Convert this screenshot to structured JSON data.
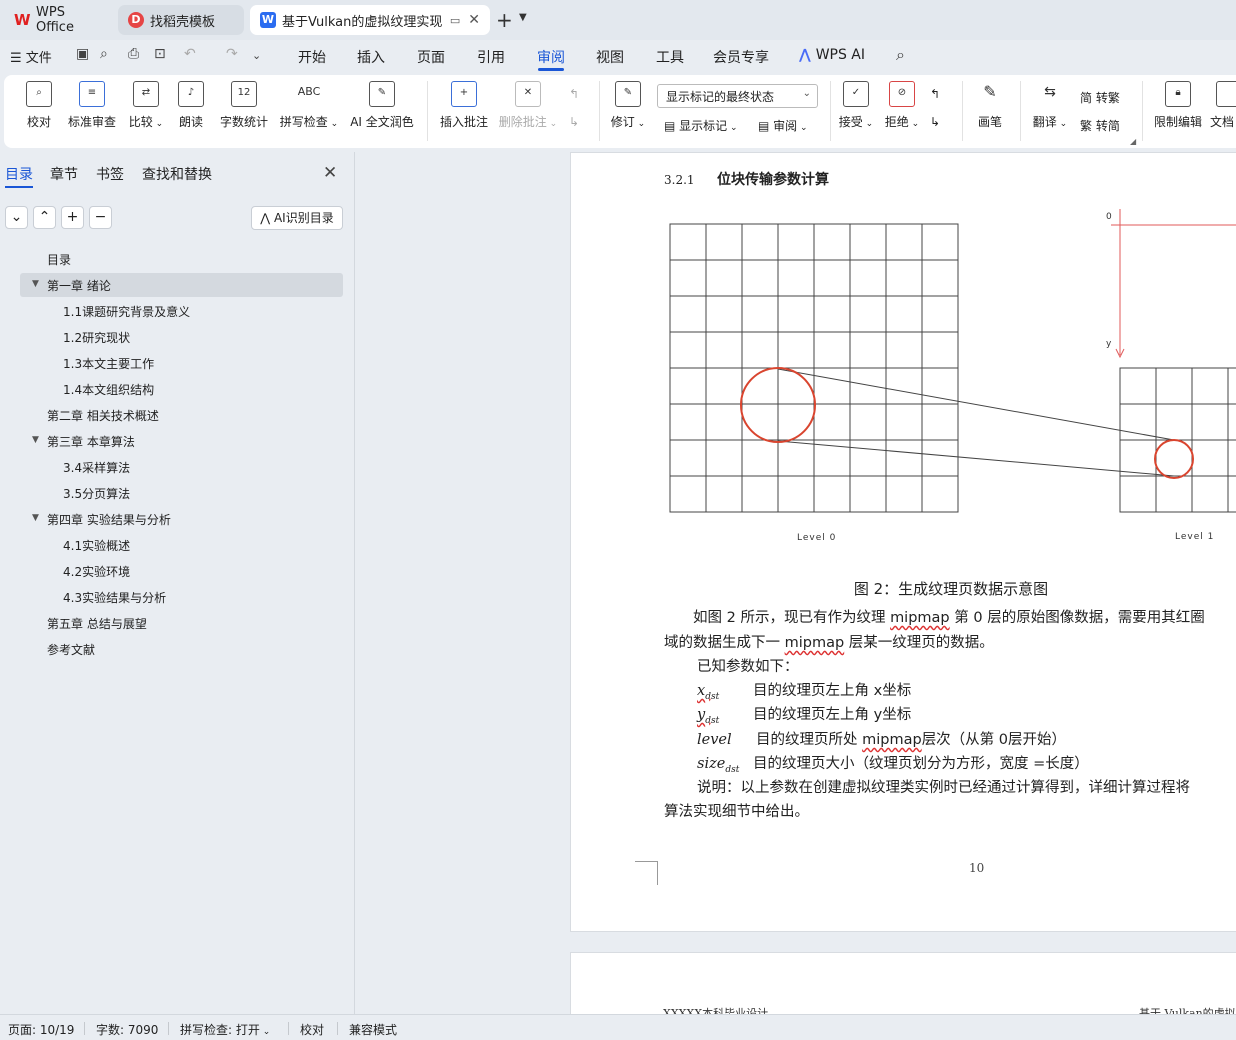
{
  "tabs": {
    "wps": "WPS Office",
    "template": "找稻壳模板",
    "document": "基于Vulkan的虚拟纹理实现 - 兰"
  },
  "menu": {
    "file": "文件",
    "items": [
      "开始",
      "插入",
      "页面",
      "引用",
      "审阅",
      "视图",
      "工具",
      "会员专享",
      "WPS AI"
    ],
    "active": "审阅"
  },
  "ribbon": {
    "proofread": "校对",
    "standard_review": "标准审查",
    "compare": "比较",
    "read_aloud": "朗读",
    "word_count": "字数统计",
    "spell_check": "拼写检查",
    "ai_polish": "AI 全文润色",
    "insert_comment": "插入批注",
    "delete_comment": "删除批注",
    "track": "修订",
    "markup_state": "显示标记的最终状态",
    "show_markup": "显示标记",
    "review": "审阅",
    "accept": "接受",
    "reject": "拒绝",
    "pen": "画笔",
    "translate": "翻译",
    "to_traditional": "转繁",
    "to_simplified": "转简",
    "restrict_edit": "限制编辑",
    "doc": "文档",
    "word_count_icon_text": "12",
    "spell_icon_text": "ABC"
  },
  "nav": {
    "tabs": [
      "目录",
      "章节",
      "书签",
      "查找和替换"
    ],
    "ai_toc": "AI识别目录",
    "toc": [
      {
        "label": "目录",
        "level": 0
      },
      {
        "label": "第一章 绪论",
        "level": 0,
        "expanded": true,
        "selected": true
      },
      {
        "label": "1.1课题研究背景及意义",
        "level": 1
      },
      {
        "label": "1.2研究现状",
        "level": 1
      },
      {
        "label": "1.3本文主要工作",
        "level": 1
      },
      {
        "label": "1.4本文组织结构",
        "level": 1
      },
      {
        "label": "第二章 相关技术概述",
        "level": 0
      },
      {
        "label": "第三章 本章算法",
        "level": 0,
        "expanded": true
      },
      {
        "label": "3.4采样算法",
        "level": 1
      },
      {
        "label": "3.5分页算法",
        "level": 1
      },
      {
        "label": "第四章 实验结果与分析",
        "level": 0,
        "expanded": true
      },
      {
        "label": "4.1实验概述",
        "level": 1
      },
      {
        "label": "4.2实验环境",
        "level": 1
      },
      {
        "label": "4.3实验结果与分析",
        "level": 1
      },
      {
        "label": "第五章 总结与展望",
        "level": 0
      },
      {
        "label": "参考文献",
        "level": 0
      }
    ]
  },
  "doc": {
    "heading_num": "3.2.1",
    "heading_text": "位块传输参数计算",
    "fig_level0": "Level 0",
    "fig_level1": "Level 1",
    "fig_axis_zero": "0",
    "fig_axis_y": "y",
    "caption": "图 2：生成纹理页数据示意图",
    "p1_a": "如图 2 所示，现已有作为纹理 ",
    "p1_mip": "mipmap",
    "p1_b": " 第 0 层的原始图像数据，需要用其红圈",
    "p2_a": "域的数据生成下一 ",
    "p2_mip": "mipmap",
    "p2_b": " 层某一纹理页的数据。",
    "known": "已知参数如下：",
    "params": [
      {
        "var": "x",
        "sub": "dst",
        "desc": "目的纹理页左上角 x坐标"
      },
      {
        "var": "y",
        "sub": "dst",
        "desc": "目的纹理页左上角 y坐标"
      },
      {
        "var": "level",
        "sub": "",
        "desc_a": "目的纹理页所处 ",
        "desc_mip": "mipmap",
        "desc_b": "层次（从第 0层开始）"
      },
      {
        "var": "size",
        "sub": "dst",
        "desc": "目的纹理页大小（纹理页划分为方形，宽度 =长度）"
      }
    ],
    "note_1": "说明：以上参数在创建虚拟纹理类实例时已经通过计算得到，详细计算过程将",
    "note_2": "算法实现细节中给出。",
    "page_number": "10",
    "footer_left": "XXXXX本科毕业设计",
    "footer_right": "基于 Vulkan的虚拟"
  },
  "status": {
    "page": "页面: 10/19",
    "words": "字数: 7090",
    "spell": "拼写检查: 打开",
    "proofread": "校对",
    "compat": "兼容模式"
  },
  "colors": {
    "accent": "#1a56d6",
    "circle_red": "#d9452f",
    "axis_red": "#e05a5a"
  }
}
